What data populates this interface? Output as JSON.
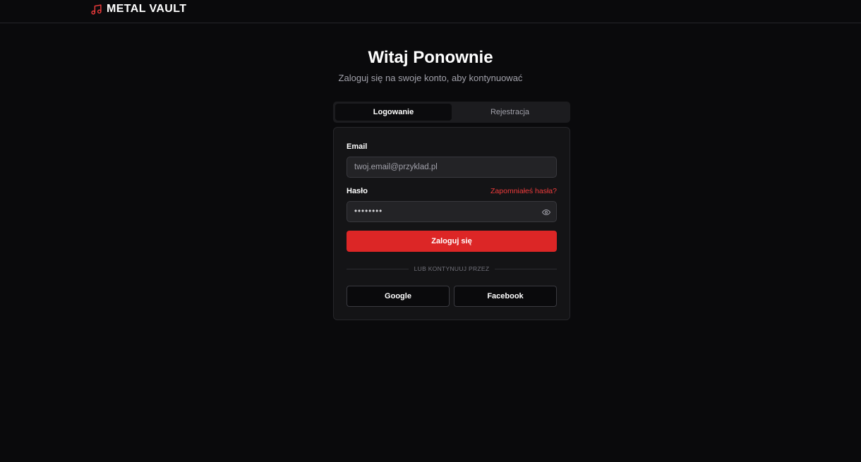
{
  "header": {
    "brand_name": "METAL VAULT",
    "brand_icon": "music-note-icon",
    "accent_color": "#dc2626"
  },
  "main": {
    "title": "Witaj Ponownie",
    "subtitle": "Zaloguj się na swoje konto, aby kontynuować"
  },
  "tabs": {
    "login_label": "Logowanie",
    "register_label": "Rejestracja",
    "active": "Logowanie"
  },
  "form": {
    "email_label": "Email",
    "email_placeholder": "twoj.email@przyklad.pl",
    "email_value": "",
    "password_label": "Hasło",
    "password_value": "••••••••",
    "forgot_label": "Zapomniałeś hasła?",
    "show_password_icon": "eye-icon",
    "submit_label": "Zaloguj się",
    "divider_text": "LUB KONTYNUUJ PRZEZ",
    "google_label": "Google",
    "facebook_label": "Facebook"
  }
}
